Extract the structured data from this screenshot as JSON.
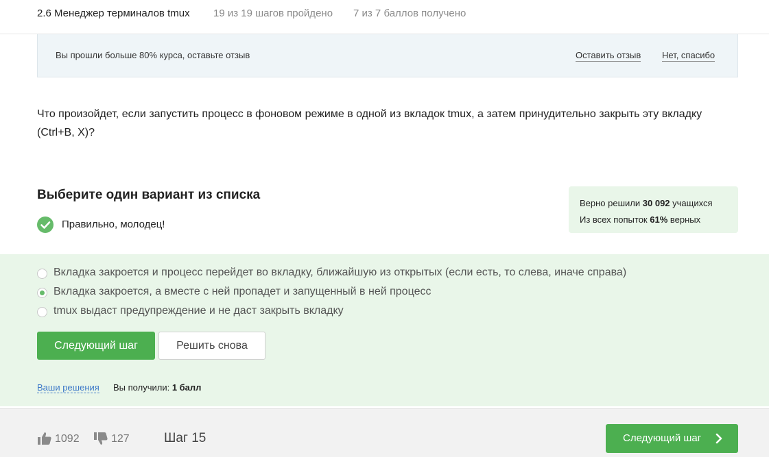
{
  "header": {
    "lesson_title": "2.6 Менеджер терминалов tmux",
    "steps_progress": "19 из 19 шагов пройдено",
    "points_progress": "7 из 7 баллов  получено"
  },
  "feedback_banner": {
    "text": "Вы прошли больше 80% курса, оставьте отзыв",
    "leave_review": "Оставить отзыв",
    "no_thanks": "Нет, спасибо"
  },
  "question": {
    "text": "Что произойдет, если запустить процесс в фоновом режиме в одной из вкладок tmux, а затем принудительно закрыть эту вкладку (Ctrl+B, X)?"
  },
  "quiz": {
    "title": "Выберите один вариант из списка",
    "result": "Правильно, молодец!",
    "options": [
      {
        "label": "Вкладка закроется и процесс перейдет во вкладку, ближайшую из открытых (если есть, то слева, иначе справа)",
        "selected": false
      },
      {
        "label": "Вкладка закроется, а вместе с ней пропадет и запущенный в ней процесс",
        "selected": true
      },
      {
        "label": "tmux выдаст предупреждение и не даст закрыть вкладку",
        "selected": false
      }
    ],
    "next_button": "Следующий шаг",
    "retry_button": "Решить снова",
    "solutions_link": "Ваши решения",
    "score_prefix": "Вы получили: ",
    "score_value": "1 балл"
  },
  "stats": {
    "solved_prefix": "Верно решили ",
    "solved_count": "30 092",
    "solved_suffix": " учащихся",
    "attempts_prefix": "Из всех попыток ",
    "attempts_percent": "61%",
    "attempts_suffix": " верных"
  },
  "footer": {
    "likes": "1092",
    "dislikes": "127",
    "step": "Шаг 15",
    "next_button": "Следующий шаг"
  },
  "colors": {
    "accent_green": "#4caf50",
    "answer_bg": "#e9f6e9",
    "link_blue": "#3c78c8"
  }
}
